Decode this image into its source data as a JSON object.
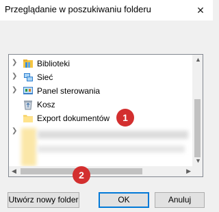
{
  "dialog": {
    "title": "Przeglądanie w poszukiwaniu folderu",
    "close_symbol": "✕"
  },
  "tree": {
    "items": [
      {
        "label": "Biblioteki",
        "icon": "libraries-icon",
        "expandable": true
      },
      {
        "label": "Sieć",
        "icon": "network-icon",
        "expandable": true
      },
      {
        "label": "Panel sterowania",
        "icon": "control-panel-icon",
        "expandable": true
      },
      {
        "label": "Kosz",
        "icon": "recycle-bin-icon",
        "expandable": false
      },
      {
        "label": "Export dokumentów",
        "icon": "folder-icon",
        "expandable": false
      }
    ]
  },
  "annotations": [
    {
      "label": "1"
    },
    {
      "label": "2"
    }
  ],
  "buttons": {
    "new_folder": "Utwórz nowy folder",
    "ok": "OK",
    "cancel": "Anuluj"
  },
  "colors": {
    "badge": "#d32f2f",
    "primary_border": "#0078d7"
  }
}
